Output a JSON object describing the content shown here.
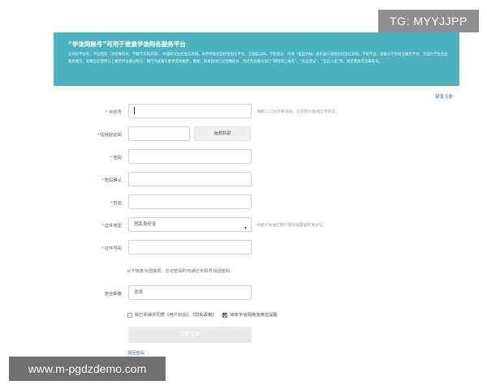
{
  "watermarks": {
    "tg": "TG: MYYJJPP",
    "url": "www.m-pgdzdemo.com"
  },
  "banner": {
    "title": "“学信网账号”可用于登录学信网各服务平台",
    "description": "支持的平台有：学信档案（含图像校对、学籍学历核对等）、中国研究生招生信息网、高考特殊类型招生报名平台、全国征兵网、学职就业、内地（祖国大陆）高校面向港澳台招生信息网、学职平台、国家大学生就业服务平台、全国大学生创业服务网等。如果您在使用以上服务时注册过账号，则可凭此账号使用其他服务，例如：如果您进行过图像校对，则可凭此账号进行“研招网上报名”、“兵役登记”、“应征入伍”等，而无需再次注册账号。"
  },
  "header_link": "紧急注册",
  "form": {
    "phone": {
      "label": "手机号",
      "value": "",
      "hint": "请输入11位手机号码，仅支持大陆地区手机号。"
    },
    "sms_code": {
      "label": "短信验证码",
      "button": "免费获取"
    },
    "password": {
      "label": "密码"
    },
    "password_confirm": {
      "label": "密码确认"
    },
    "name": {
      "label": "姓名"
    },
    "id_type": {
      "label": "证件类型",
      "selected": "居民身份证",
      "hint": "中国大陆地区用户需持设置居民身份证。"
    },
    "id_number": {
      "label": "证件号码"
    },
    "optional_note": "以下信息为选填项，忘记密码时可通过手机号找回密码",
    "email": {
      "label": "安全邮箱",
      "placeholder": "选填"
    },
    "agree_text": "我已阅读并同意《用户协议》、《隐私政策》",
    "receive_text": "接收学信网微信推送提醒",
    "submit": "立即注册",
    "find_password": "找回密码"
  }
}
